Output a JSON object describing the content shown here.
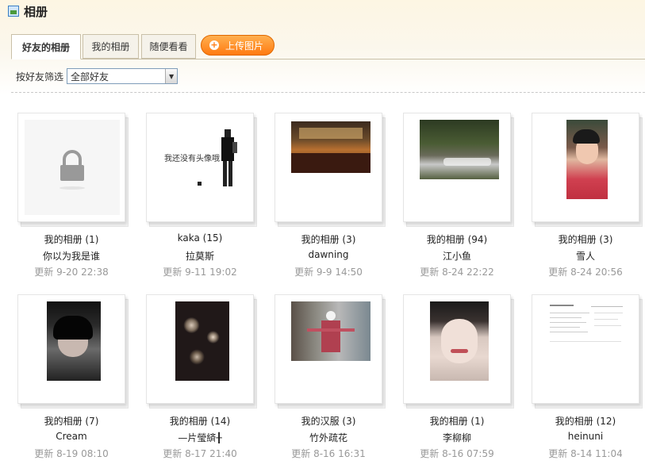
{
  "page": {
    "title": "相册",
    "title_icon": "photo-album-icon"
  },
  "tabs": [
    {
      "label": "好友的相册",
      "active": true
    },
    {
      "label": "我的相册",
      "active": false
    },
    {
      "label": "随便看看",
      "active": false
    }
  ],
  "upload_button": {
    "label": "上传图片",
    "icon": "plus-icon"
  },
  "filter": {
    "label": "按好友筛选",
    "selected": "全部好友"
  },
  "albums": [
    {
      "title": "我的相册 (1)",
      "owner": "你以为我是谁",
      "updated": "更新 9-20 22:38",
      "thumb": "lock"
    },
    {
      "title": "kaka (15)",
      "owner": "拉莫斯",
      "updated": "更新 9-11 19:02",
      "thumb": "noavatar",
      "thumb_text": "我还没有头像哦"
    },
    {
      "title": "我的相册 (3)",
      "owner": "dawning",
      "updated": "更新 9-9 14:50",
      "thumb": "restaurant"
    },
    {
      "title": "我的相册 (94)",
      "owner": "江小鱼",
      "updated": "更新 8-24 22:22",
      "thumb": "river"
    },
    {
      "title": "我的相册 (3)",
      "owner": "雪人",
      "updated": "更新 8-24 20:56",
      "thumb": "girl"
    },
    {
      "title": "我的相册 (7)",
      "owner": "Cream",
      "updated": "更新 8-19 08:10",
      "thumb": "boy"
    },
    {
      "title": "我的相册 (14)",
      "owner": "—片瑩緕╂",
      "updated": "更新 8-17 21:40",
      "thumb": "bokeh"
    },
    {
      "title": "我的汉服 (3)",
      "owner": "竹外疏花",
      "updated": "更新 8-16 16:31",
      "thumb": "hanfu"
    },
    {
      "title": "我的相册 (1)",
      "owner": "李柳柳",
      "updated": "更新 8-16 07:59",
      "thumb": "face"
    },
    {
      "title": "我的相册 (12)",
      "owner": "heinuni",
      "updated": "更新 8-14 11:04",
      "thumb": "document"
    }
  ]
}
